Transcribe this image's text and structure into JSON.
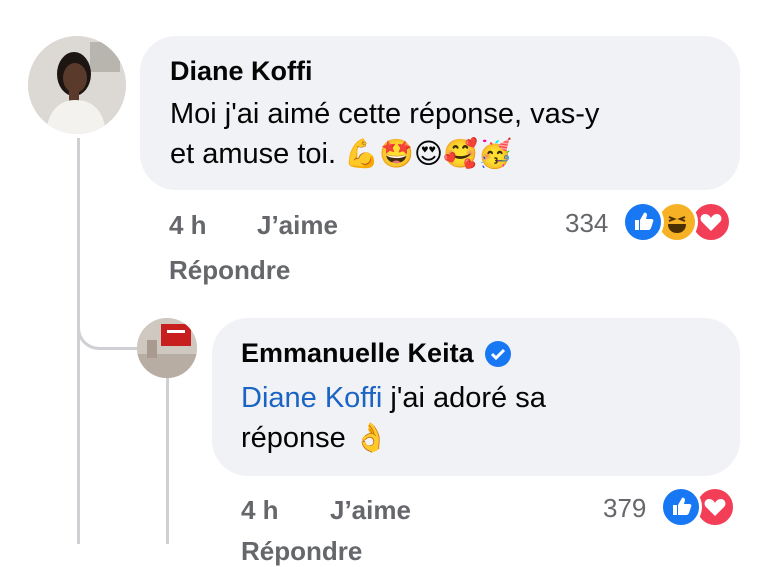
{
  "comment": {
    "author": "Diane Koffi",
    "text_line1": "Moi j'ai aimé cette réponse, vas-y",
    "text_line2": "et amuse toi.",
    "emojis": "💪🤩😍🥰🥳",
    "time": "4 h",
    "like_label": "J’aime",
    "reply_label": "Répondre",
    "reaction_count": "334",
    "reactions": [
      "like-icon",
      "haha-icon",
      "love-icon"
    ]
  },
  "reply": {
    "author": "Emmanuelle Keita",
    "verified": true,
    "mention": "Diane Koffi",
    "text_line1": " j'ai adoré sa",
    "text_line2": "réponse",
    "emoji": "👌",
    "time": "4 h",
    "like_label": "J’aime",
    "reply_label": "Répondre",
    "reaction_count": "379",
    "reactions": [
      "like-icon",
      "love-icon"
    ]
  },
  "colors": {
    "like": "#1877f2",
    "love": "#f33e58",
    "haha": "#f7b125",
    "bubble": "#f0f2f5",
    "mention": "#1b64c4"
  }
}
